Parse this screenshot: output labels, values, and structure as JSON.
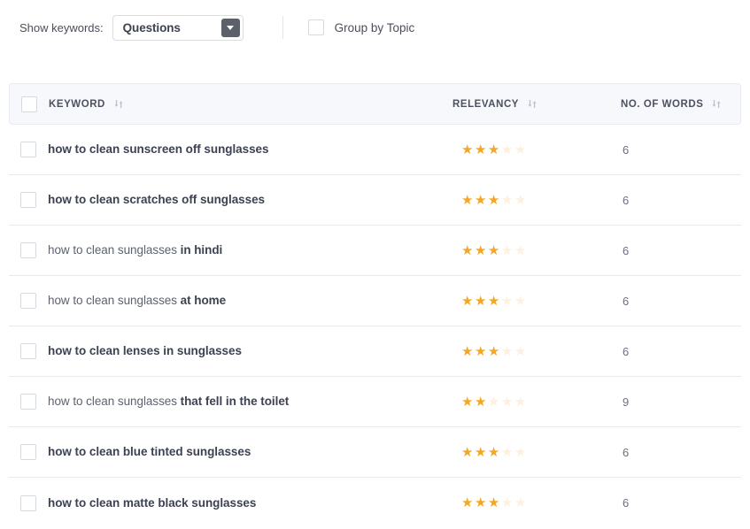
{
  "toolbar": {
    "show_keywords_label": "Show keywords:",
    "select": {
      "value": "Questions",
      "arrow_icon": "chevron-down-icon"
    },
    "group_by_topic": {
      "label": "Group by Topic",
      "checked": false
    }
  },
  "table": {
    "columns": [
      {
        "key": "keyword",
        "label": "KEYWORD",
        "sort_icon": "sort-updown-icon"
      },
      {
        "key": "relevancy",
        "label": "RELEVANCY",
        "sort_icon": "sort-updown-icon"
      },
      {
        "key": "words",
        "label": "NO. OF WORDS",
        "sort_icon": "sort-updown-icon"
      }
    ],
    "select_all_checked": false,
    "max_stars": 5,
    "rows": [
      {
        "prefix": "",
        "highlight": "how to clean sunscreen off sunglasses",
        "relevancy": 3,
        "words": 6,
        "checked": false
      },
      {
        "prefix": "",
        "highlight": "how to clean scratches off sunglasses",
        "relevancy": 3,
        "words": 6,
        "checked": false
      },
      {
        "prefix": "how to clean sunglasses ",
        "highlight": "in hindi",
        "relevancy": 3,
        "words": 6,
        "checked": false
      },
      {
        "prefix": "how to clean sunglasses ",
        "highlight": "at home",
        "relevancy": 3,
        "words": 6,
        "checked": false
      },
      {
        "prefix": "",
        "highlight": "how to clean lenses in sunglasses",
        "relevancy": 3,
        "words": 6,
        "checked": false
      },
      {
        "prefix": "how to clean sunglasses ",
        "highlight": "that fell in the toilet",
        "relevancy": 2,
        "words": 9,
        "checked": false
      },
      {
        "prefix": "",
        "highlight": "how to clean blue tinted sunglasses",
        "relevancy": 3,
        "words": 6,
        "checked": false
      },
      {
        "prefix": "",
        "highlight": "how to clean matte black sunglasses",
        "relevancy": 3,
        "words": 6,
        "checked": false
      }
    ]
  },
  "colors": {
    "star_filled": "#f5a623",
    "star_empty": "#fdf0e0",
    "header_bg": "#f7f8fb",
    "text_primary": "#3c4252"
  }
}
